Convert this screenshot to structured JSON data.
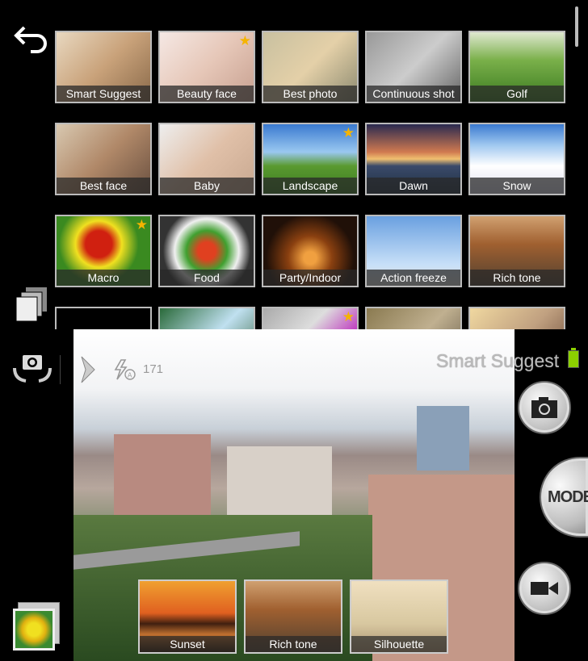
{
  "modes": [
    {
      "label": "Smart Suggest",
      "starred": false,
      "bg": "linear-gradient(135deg,#e8d8c0,#c9a27a 50%,#8a6a4a)"
    },
    {
      "label": "Beauty face",
      "starred": true,
      "bg": "linear-gradient(135deg,#f5e8e4,#e6c7b8 50%,#c7a090)"
    },
    {
      "label": "Best photo",
      "starred": false,
      "bg": "linear-gradient(135deg,#c8c0a0,#e4d0a8 50%,#8c8a70)"
    },
    {
      "label": "Continuous shot",
      "starred": false,
      "bg": "linear-gradient(135deg,#999,#ccc 50%,#666)"
    },
    {
      "label": "Golf",
      "starred": false,
      "bg": "linear-gradient(#dfe8d0,#7ab04a 40%,#3a7a20)"
    },
    {
      "label": "Best face",
      "starred": false,
      "bg": "linear-gradient(135deg,#d8c8b0,#b08868 50%,#6a5040)"
    },
    {
      "label": "Baby",
      "starred": false,
      "bg": "linear-gradient(135deg,#eee,#e0c0a8 50%,#c8a890)"
    },
    {
      "label": "Landscape",
      "starred": true,
      "bg": "linear-gradient(#3a7ad0,#9ac8f0 40%,#5a9a30 60%,#3a7a20)"
    },
    {
      "label": "Dawn",
      "starred": false,
      "bg": "linear-gradient(#2a2a50,#d07a50 40%,#f0c070 50%,#3a4a6a 60%,#203040)"
    },
    {
      "label": "Snow",
      "starred": false,
      "bg": "linear-gradient(#3a7ad0,#a0c8f0 30%,#fff 60%,#dde)"
    },
    {
      "label": "Macro",
      "starred": true,
      "bg": "radial-gradient(circle at 45% 40%,#d02010 20%,#f0e020 35%,#3a8a20 60%)"
    },
    {
      "label": "Food",
      "starred": false,
      "bg": "radial-gradient(circle,#e04020 15%,#40a030 35%,#f0f0f0 55%,#333 75%)"
    },
    {
      "label": "Party/Indoor",
      "starred": false,
      "bg": "radial-gradient(circle at 50% 60%,#f0a040 10%,#8a4010 35%,#201008 70%)"
    },
    {
      "label": "Action freeze",
      "starred": false,
      "bg": "linear-gradient(#6aa0e0,#c8e0f8 70%,#ddd)"
    },
    {
      "label": "Rich tone",
      "starred": false,
      "bg": "linear-gradient(#d0a070,#a06030 40%,#504030)"
    },
    {
      "label": "",
      "starred": false,
      "bg": "linear-gradient(#000 60%,#8ab0e0)"
    },
    {
      "label": "",
      "starred": false,
      "bg": "linear-gradient(135deg,#2a6a3a,#c0e0f0 50%,#2a5a30)"
    },
    {
      "label": "",
      "starred": true,
      "bg": "linear-gradient(135deg,#aaa,#ddd 40%,#c040c0 70%)"
    },
    {
      "label": "",
      "starred": false,
      "bg": "linear-gradient(135deg,#8a7a50,#c0b090 50%,#5a5040)"
    },
    {
      "label": "",
      "starred": false,
      "bg": "linear-gradient(135deg,#f0d8a0,#c0a080 50%,#604030)"
    }
  ],
  "status": {
    "mode_name": "Smart Suggest",
    "shots_remaining": "171",
    "flash": "auto"
  },
  "controls": {
    "mode_label": "MODE"
  },
  "suggestions": [
    {
      "label": "Sunset",
      "bg": "linear-gradient(#f0a030,#e06020 45%,#402010 60%,#c07030 75%,#301808)"
    },
    {
      "label": "Rich tone",
      "bg": "linear-gradient(#d0a070,#a06030 40%,#504030)"
    },
    {
      "label": "Silhouette",
      "bg": "linear-gradient(#f0e0c0,#d8c8a0 60%,#a89070)"
    }
  ],
  "colors": {
    "battery": "#8cd000",
    "star": "#f5b400"
  }
}
